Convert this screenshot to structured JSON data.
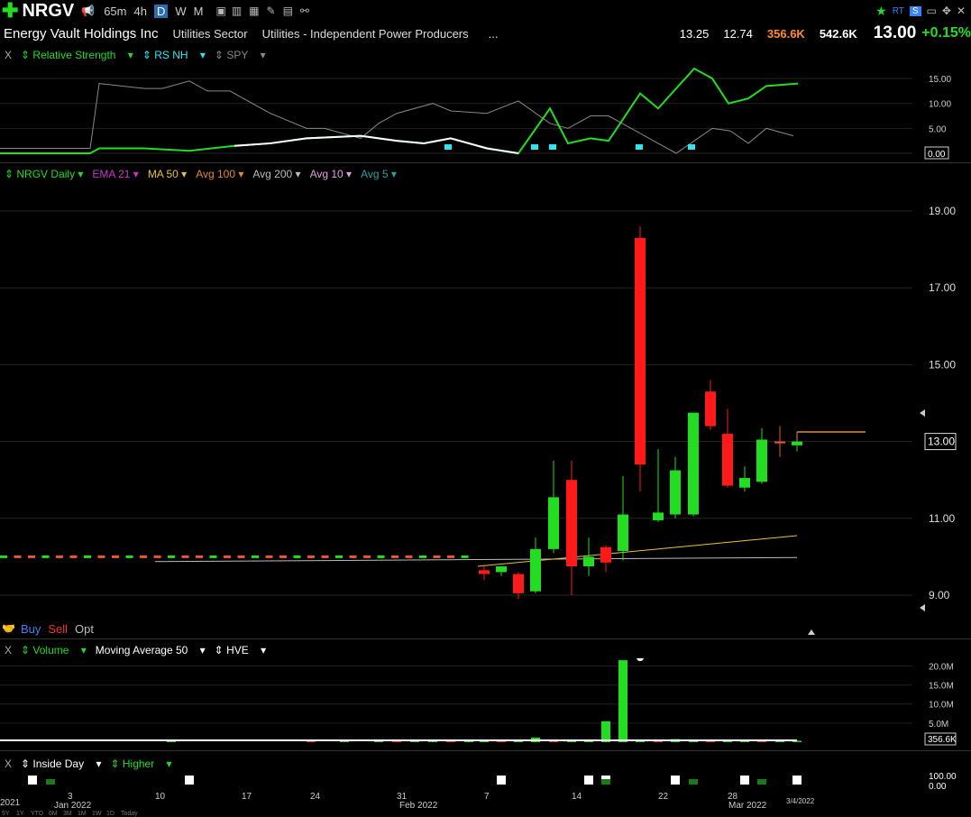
{
  "header": {
    "symbol": "NRGV",
    "timeframes": [
      "65m",
      "4h",
      "D",
      "W",
      "M"
    ],
    "active_timeframe": "D",
    "company": "Energy Vault Holdings Inc",
    "sector": "Utilities Sector",
    "industry": "Utilities - Independent Power Producers",
    "ellipsis": "...",
    "stat1": "13.25",
    "stat2": "12.74",
    "stat3": "356.6K",
    "stat4": "542.6K",
    "price": "13.00",
    "change": "+0.15%",
    "rt_label": "RT",
    "s_label": "S"
  },
  "rs_pane": {
    "close": "X",
    "items": [
      "Relative Strength",
      "RS NH",
      "SPY"
    ],
    "y_labels": [
      "15.00",
      "10.00",
      "5.00",
      "0.00"
    ],
    "last_value": "0.00"
  },
  "price_pane": {
    "items": [
      "NRGV Daily",
      "EMA 21",
      "MA 50",
      "Avg 100",
      "Avg 200",
      "Avg 10",
      "Avg 5"
    ],
    "colors": [
      "#22dd22",
      "#cc33cc",
      "#e8c040",
      "#e08a2a",
      "#bbbbbb",
      "#e0a0e0",
      "#2aa0a0"
    ],
    "y_labels": [
      "19.00",
      "17.00",
      "15.00",
      "13.00",
      "11.00",
      "9.00"
    ],
    "last_price": "13.00",
    "trade": [
      "Buy",
      "Sell",
      "Opt"
    ]
  },
  "volume_pane": {
    "close": "X",
    "items": [
      "Volume",
      "Moving Average 50",
      "HVE"
    ],
    "y_labels": [
      "20.0M",
      "15.0M",
      "10.0M",
      "5.0M"
    ],
    "last_volume": "356.6K"
  },
  "inside_pane": {
    "close": "X",
    "items": [
      "Inside Day",
      "Higher"
    ],
    "y_labels": [
      "100.00",
      "0.00"
    ]
  },
  "x_axis": {
    "labels": [
      "2021",
      "3",
      "Jan 2022",
      "10",
      "17",
      "24",
      "31",
      "Feb 2022",
      "7",
      "14",
      "22",
      "28",
      "Mar 2022",
      "3/4/2022"
    ],
    "range_buttons": [
      "5Y",
      "1Y",
      "YTD",
      "6M",
      "3M",
      "1M",
      "1W",
      "1D",
      "Today"
    ]
  },
  "chart_data": {
    "type": "candlestick",
    "title": "NRGV Daily",
    "ylim": [
      8,
      20
    ],
    "candles_before_ipo_flat": 10.0,
    "candles": [
      {
        "o": 9.65,
        "h": 9.8,
        "l": 9.4,
        "c": 9.55
      },
      {
        "o": 9.6,
        "h": 9.75,
        "l": 9.5,
        "c": 9.75
      },
      {
        "o": 9.55,
        "h": 9.6,
        "l": 8.9,
        "c": 9.05
      },
      {
        "o": 9.1,
        "h": 10.5,
        "l": 9.05,
        "c": 10.2
      },
      {
        "o": 10.2,
        "h": 12.5,
        "l": 10.1,
        "c": 11.55
      },
      {
        "o": 12.0,
        "h": 12.5,
        "l": 9.0,
        "c": 9.75
      },
      {
        "o": 9.75,
        "h": 10.5,
        "l": 9.5,
        "c": 10.0
      },
      {
        "o": 10.25,
        "h": 10.3,
        "l": 9.6,
        "c": 9.85
      },
      {
        "o": 10.15,
        "h": 12.1,
        "l": 9.9,
        "c": 11.1
      },
      {
        "o": 18.3,
        "h": 18.6,
        "l": 11.7,
        "c": 12.4
      },
      {
        "o": 10.95,
        "h": 12.8,
        "l": 10.9,
        "c": 11.15
      },
      {
        "o": 11.1,
        "h": 12.6,
        "l": 11.0,
        "c": 12.25
      },
      {
        "o": 11.1,
        "h": 12.9,
        "l": 11.05,
        "c": 13.75
      },
      {
        "o": 14.3,
        "h": 14.6,
        "l": 13.3,
        "c": 13.4
      },
      {
        "o": 13.2,
        "h": 13.85,
        "l": 11.8,
        "c": 11.85
      },
      {
        "o": 11.8,
        "h": 12.35,
        "l": 11.7,
        "c": 12.05
      },
      {
        "o": 11.95,
        "h": 13.35,
        "l": 11.9,
        "c": 13.05
      },
      {
        "o": 13.0,
        "h": 13.4,
        "l": 12.6,
        "c": 13.0
      },
      {
        "o": 12.9,
        "h": 13.25,
        "l": 12.74,
        "c": 13.0
      }
    ],
    "ma50": [
      9.75,
      9.8,
      9.85,
      9.9,
      9.95,
      10.0,
      10.05,
      10.1,
      10.15,
      10.2,
      10.25,
      10.3,
      10.35,
      10.4,
      10.45,
      10.5,
      10.55
    ],
    "ma200_level": 9.85,
    "volume_m": [
      0.4,
      0.3,
      0.5,
      0.4,
      0.3,
      0.4,
      0.3,
      0.3,
      0.5,
      0.4,
      0.3,
      0.6,
      0.4,
      0.3,
      0.5,
      0.7,
      1.2,
      0.4,
      0.3,
      0.5,
      5.5,
      21.5,
      0.5,
      0.3,
      0.8,
      0.4,
      0.5,
      0.3,
      0.4,
      0.3,
      0.4,
      0.36
    ],
    "volume_ylim": [
      0,
      22
    ]
  }
}
